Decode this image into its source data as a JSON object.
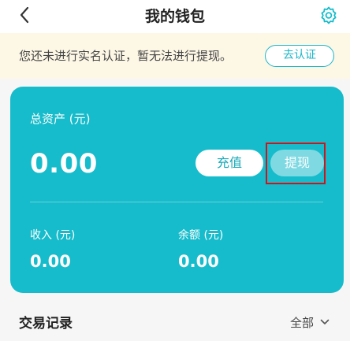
{
  "header": {
    "title": "我的钱包",
    "back_icon": "chevron-left-icon",
    "settings_icon": "gear-icon"
  },
  "notice": {
    "text": "您还未进行实名认证，暂无法进行提现。",
    "button_label": "去认证"
  },
  "wallet": {
    "total_label": "总资产 (元)",
    "total_value": "0.00",
    "recharge_label": "充值",
    "withdraw_label": "提现",
    "income_label": "收入 (元)",
    "income_value": "0.00",
    "balance_label": "余额 (元)",
    "balance_value": "0.00"
  },
  "records": {
    "title": "交易记录",
    "filter_label": "全部",
    "filter_icon": "chevron-down-icon"
  },
  "colors": {
    "accent": "#16bccb",
    "notice_bg": "#fdf7e6",
    "highlight": "#d0141c"
  }
}
